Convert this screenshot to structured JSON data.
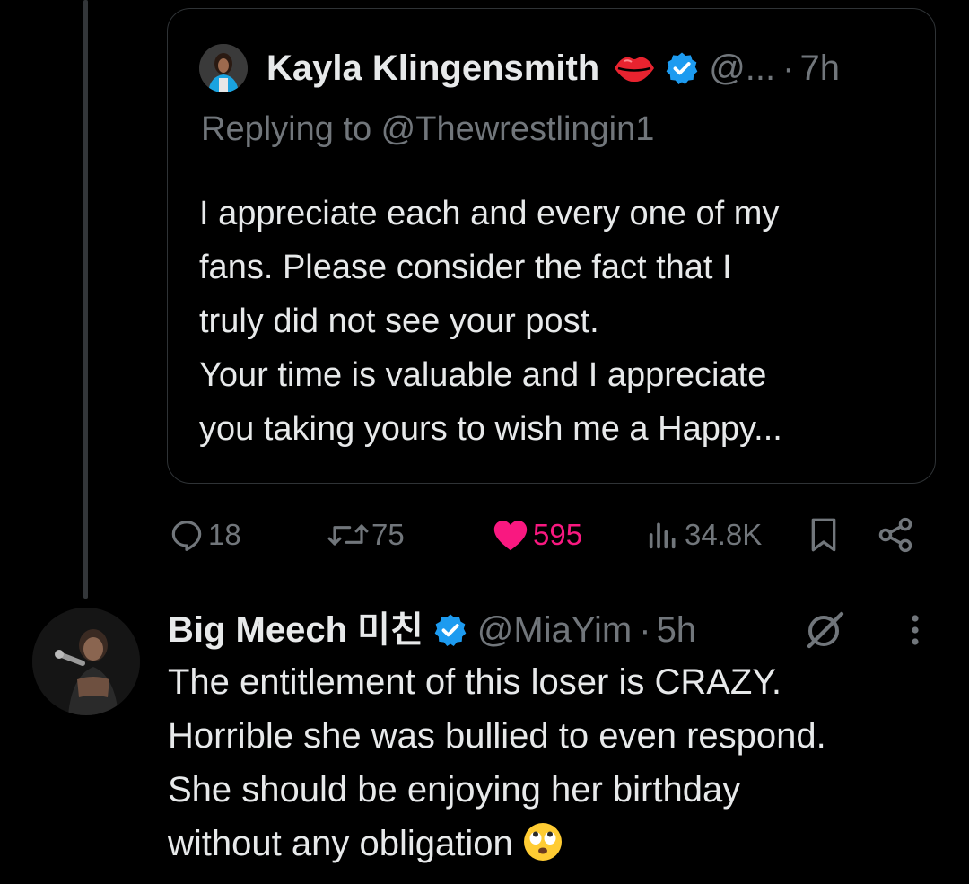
{
  "quoted_tweet": {
    "author_name": "Kayla Klingensmith",
    "author_handle": "@...",
    "separator": "·",
    "time": "7h",
    "replying_to": "Replying to @Thewrestlingin1",
    "body_lines": [
      "I appreciate each and every one of my",
      "fans. Please consider the fact that I",
      "truly did not see your post.",
      "Your time is valuable and I appreciate",
      "you taking yours to wish me a Happy..."
    ]
  },
  "actions": {
    "replies": "18",
    "reposts": "75",
    "likes": "595",
    "views": "34.8K"
  },
  "reply_tweet": {
    "author_name": "Big Meech 미친",
    "author_handle": "@MiaYim",
    "separator": "·",
    "time": "5h",
    "body_lines": [
      "The entitlement of this loser is CRAZY.",
      "Horrible she was bullied to even respond.",
      "She should be enjoying her birthday",
      "without any obligation"
    ],
    "trailing_emoji": "face-with-rolling-eyes-icon"
  },
  "colors": {
    "background": "#000000",
    "primary_text": "#e7e9ea",
    "secondary_text": "#71767b",
    "verified_blue": "#1d9bf0",
    "like_pink": "#f91880",
    "border": "#2f3336",
    "thread_line": "#333639",
    "lips_red": "#e8232f"
  }
}
